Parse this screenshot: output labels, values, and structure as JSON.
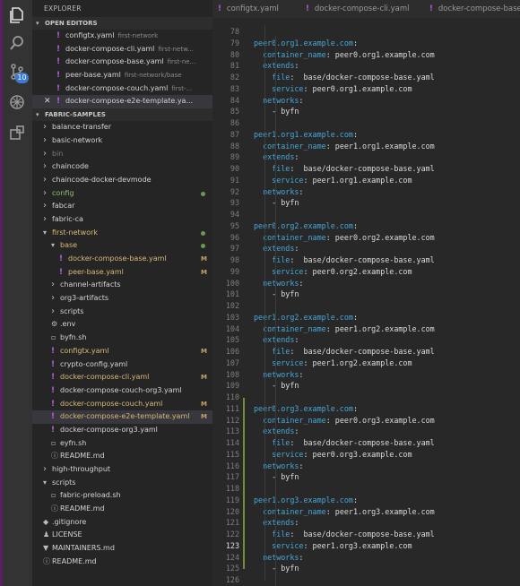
{
  "activity_bar": {
    "scm_badge": "10"
  },
  "explorer": {
    "title": "EXPLORER",
    "open_editors": {
      "title": "OPEN EDITORS",
      "items": [
        {
          "name": "configtx.yaml",
          "desc": "first-network",
          "close": ""
        },
        {
          "name": "docker-compose-cli.yaml",
          "desc": "first-netw...",
          "close": ""
        },
        {
          "name": "docker-compose-base.yaml",
          "desc": "first-ne...",
          "close": ""
        },
        {
          "name": "peer-base.yaml",
          "desc": "first-network/base",
          "close": ""
        },
        {
          "name": "docker-compose-couch.yaml",
          "desc": "first-...",
          "close": ""
        },
        {
          "name": "docker-compose-e2e-template.ya...",
          "desc": "",
          "close": "✕"
        }
      ]
    },
    "project": {
      "title": "FABRIC-SAMPLES",
      "items": [
        {
          "label": "balance-transfer",
          "indent": 0,
          "kind": "folder",
          "status": ""
        },
        {
          "label": "basic-network",
          "indent": 0,
          "kind": "folder",
          "status": ""
        },
        {
          "label": "bin",
          "indent": 0,
          "kind": "folder",
          "status": "",
          "style": "dim"
        },
        {
          "label": "chaincode",
          "indent": 0,
          "kind": "folder",
          "status": ""
        },
        {
          "label": "chaincode-docker-devmode",
          "indent": 0,
          "kind": "folder",
          "status": ""
        },
        {
          "label": "config",
          "indent": 0,
          "kind": "folder",
          "status": "dot",
          "style": "grn"
        },
        {
          "label": "fabcar",
          "indent": 0,
          "kind": "folder",
          "status": ""
        },
        {
          "label": "fabric-ca",
          "indent": 0,
          "kind": "folder",
          "status": ""
        },
        {
          "label": "first-network",
          "indent": 0,
          "kind": "folder-open",
          "status": "dot",
          "style": "mod"
        },
        {
          "label": "base",
          "indent": 1,
          "kind": "folder-open",
          "status": "dot",
          "style": "mod"
        },
        {
          "label": "docker-compose-base.yaml",
          "indent": 2,
          "kind": "yaml",
          "status": "M",
          "style": "mod"
        },
        {
          "label": "peer-base.yaml",
          "indent": 2,
          "kind": "yaml",
          "status": "M",
          "style": "mod"
        },
        {
          "label": "channel-artifacts",
          "indent": 1,
          "kind": "folder",
          "status": ""
        },
        {
          "label": "org3-artifacts",
          "indent": 1,
          "kind": "folder",
          "status": ""
        },
        {
          "label": "scripts",
          "indent": 1,
          "kind": "folder",
          "status": ""
        },
        {
          "label": ".env",
          "indent": 1,
          "kind": "gear",
          "status": ""
        },
        {
          "label": "byfn.sh",
          "indent": 1,
          "kind": "file",
          "status": ""
        },
        {
          "label": "configtx.yaml",
          "indent": 1,
          "kind": "yaml",
          "status": "M",
          "style": "mod"
        },
        {
          "label": "crypto-config.yaml",
          "indent": 1,
          "kind": "yaml",
          "status": ""
        },
        {
          "label": "docker-compose-cli.yaml",
          "indent": 1,
          "kind": "yaml",
          "status": "M",
          "style": "mod"
        },
        {
          "label": "docker-compose-couch-org3.yaml",
          "indent": 1,
          "kind": "yaml",
          "status": ""
        },
        {
          "label": "docker-compose-couch.yaml",
          "indent": 1,
          "kind": "yaml",
          "status": "M",
          "style": "mod"
        },
        {
          "label": "docker-compose-e2e-template.yaml",
          "indent": 1,
          "kind": "yaml",
          "status": "M",
          "style": "mod",
          "selected": true
        },
        {
          "label": "docker-compose-org3.yaml",
          "indent": 1,
          "kind": "yaml",
          "status": ""
        },
        {
          "label": "eyfn.sh",
          "indent": 1,
          "kind": "file",
          "status": ""
        },
        {
          "label": "README.md",
          "indent": 1,
          "kind": "info",
          "status": ""
        },
        {
          "label": "high-throughput",
          "indent": 0,
          "kind": "folder",
          "status": ""
        },
        {
          "label": "scripts",
          "indent": 0,
          "kind": "folder-open",
          "status": ""
        },
        {
          "label": "fabric-preload.sh",
          "indent": 1,
          "kind": "file",
          "status": ""
        },
        {
          "label": "README.md",
          "indent": 1,
          "kind": "info",
          "status": ""
        },
        {
          "label": ".gitignore",
          "indent": 0,
          "kind": "git",
          "status": ""
        },
        {
          "label": "LICENSE",
          "indent": 0,
          "kind": "person",
          "status": ""
        },
        {
          "label": "MAINTAINERS.md",
          "indent": 0,
          "kind": "md",
          "status": ""
        },
        {
          "label": "README.md",
          "indent": 0,
          "kind": "info",
          "status": ""
        }
      ]
    }
  },
  "tabs": [
    {
      "label": "configtx.yaml"
    },
    {
      "label": "docker-compose-cli.yaml"
    },
    {
      "label": "docker-compose-base.y"
    }
  ],
  "editor": {
    "current_line": 123,
    "lines": [
      {
        "n": 78,
        "t": ""
      },
      {
        "n": 79,
        "t": "peer0.org1.example.com:"
      },
      {
        "n": 80,
        "t": "  container_name: peer0.org1.example.com"
      },
      {
        "n": 81,
        "t": "  extends:"
      },
      {
        "n": 82,
        "t": "    file:  base/docker-compose-base.yaml"
      },
      {
        "n": 83,
        "t": "    service: peer0.org1.example.com"
      },
      {
        "n": 84,
        "t": "  networks:"
      },
      {
        "n": 85,
        "t": "    - byfn"
      },
      {
        "n": 86,
        "t": ""
      },
      {
        "n": 87,
        "t": "peer1.org1.example.com:"
      },
      {
        "n": 88,
        "t": "  container_name: peer1.org1.example.com"
      },
      {
        "n": 89,
        "t": "  extends:"
      },
      {
        "n": 90,
        "t": "    file:  base/docker-compose-base.yaml"
      },
      {
        "n": 91,
        "t": "    service: peer1.org1.example.com"
      },
      {
        "n": 92,
        "t": "  networks:"
      },
      {
        "n": 93,
        "t": "    - byfn"
      },
      {
        "n": 94,
        "t": ""
      },
      {
        "n": 95,
        "t": "peer0.org2.example.com:"
      },
      {
        "n": 96,
        "t": "  container_name: peer0.org2.example.com"
      },
      {
        "n": 97,
        "t": "  extends:"
      },
      {
        "n": 98,
        "t": "    file:  base/docker-compose-base.yaml"
      },
      {
        "n": 99,
        "t": "    service: peer0.org2.example.com"
      },
      {
        "n": 100,
        "t": "  networks:"
      },
      {
        "n": 101,
        "t": "    - byfn"
      },
      {
        "n": 102,
        "t": ""
      },
      {
        "n": 103,
        "t": "peer1.org2.example.com:"
      },
      {
        "n": 104,
        "t": "  container_name: peer1.org2.example.com"
      },
      {
        "n": 105,
        "t": "  extends:"
      },
      {
        "n": 106,
        "t": "    file:  base/docker-compose-base.yaml"
      },
      {
        "n": 107,
        "t": "    service: peer1.org2.example.com"
      },
      {
        "n": 108,
        "t": "  networks:"
      },
      {
        "n": 109,
        "t": "    - byfn"
      },
      {
        "n": 110,
        "t": ""
      },
      {
        "n": 111,
        "t": "peer0.org3.example.com:"
      },
      {
        "n": 112,
        "t": "  container_name: peer0.org3.example.com"
      },
      {
        "n": 113,
        "t": "  extends:"
      },
      {
        "n": 114,
        "t": "    file:  base/docker-compose-base.yaml"
      },
      {
        "n": 115,
        "t": "    service: peer0.org3.example.com"
      },
      {
        "n": 116,
        "t": "  networks:"
      },
      {
        "n": 117,
        "t": "    - byfn"
      },
      {
        "n": 118,
        "t": ""
      },
      {
        "n": 119,
        "t": "peer1.org3.example.com:"
      },
      {
        "n": 120,
        "t": "  container_name: peer1.org3.example.com"
      },
      {
        "n": 121,
        "t": "  extends:"
      },
      {
        "n": 122,
        "t": "    file:  base/docker-compose-base.yaml"
      },
      {
        "n": 123,
        "t": "    service: peer1.org3.example.com"
      },
      {
        "n": 124,
        "t": "  networks:"
      },
      {
        "n": 125,
        "t": "    - byfn"
      },
      {
        "n": 126,
        "t": ""
      }
    ]
  },
  "colors": {
    "key": "#47a8d8",
    "value": "#dcdcdc",
    "modified": "#d9b976",
    "yaml_icon": "#b260d8"
  }
}
